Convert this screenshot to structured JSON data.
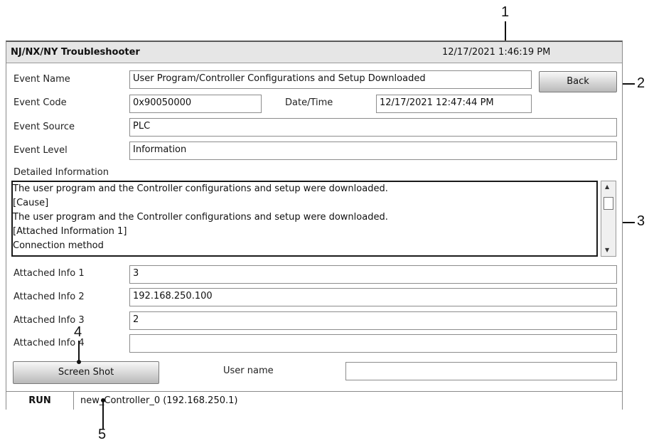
{
  "window": {
    "title": "NJ/NX/NY Troubleshooter",
    "datetime": "12/17/2021 1:46:19 PM"
  },
  "event": {
    "name_label": "Event Name",
    "name_value": "User Program/Controller Configurations and Setup Downloaded",
    "back_label": "Back",
    "code_label": "Event Code",
    "code_value": "0x90050000",
    "datetime_label": "Date/Time",
    "datetime_value": "12/17/2021 12:47:44 PM",
    "source_label": "Event Source",
    "source_value": "PLC",
    "level_label": "Event Level",
    "level_value": "Information"
  },
  "detail": {
    "label": "Detailed Information",
    "lines": [
      "The user program and the Controller configurations and setup were downloaded.",
      "[Cause]",
      "The user program and the Controller configurations and setup were downloaded.",
      "[Attached Information 1]",
      "Connection method"
    ]
  },
  "attached": [
    {
      "label": "Attached Info 1",
      "value": "3"
    },
    {
      "label": "Attached Info 2",
      "value": "192.168.250.100"
    },
    {
      "label": "Attached Info 3",
      "value": "2"
    },
    {
      "label": "Attached Info 4",
      "value": ""
    }
  ],
  "footer": {
    "screenshot_label": "Screen Shot",
    "username_label": "User name",
    "username_value": ""
  },
  "status": {
    "mode": "RUN",
    "controller": "new_Controller_0 (192.168.250.1)"
  },
  "callouts": {
    "c1": "1",
    "c2": "2",
    "c3": "3",
    "c4": "4",
    "c5": "5"
  },
  "icons": {
    "scroll_up": "triangle-up",
    "scroll_down": "triangle-down"
  }
}
